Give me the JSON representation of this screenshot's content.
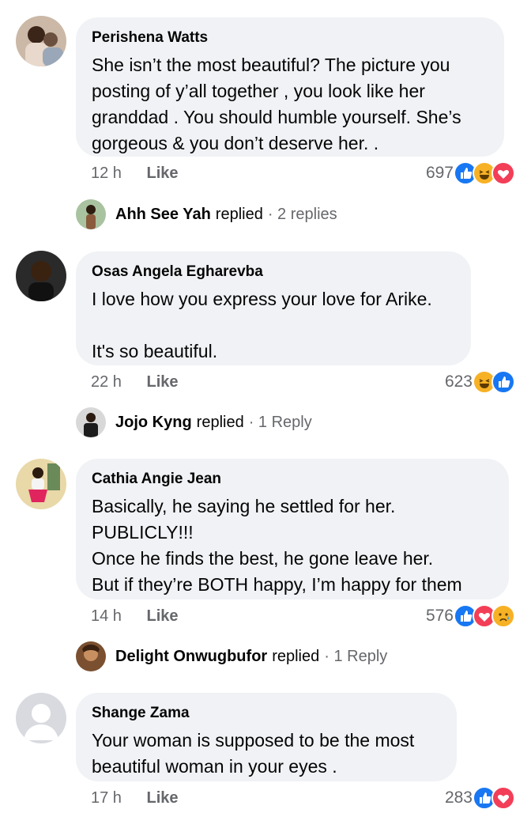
{
  "comments": [
    {
      "author": "Perishena Watts",
      "text": "She isn’t the most beautiful? The picture you posting of y’all together , you look like her granddad . You should humble yourself. She’s gorgeous & you don’t deserve her. .",
      "time": "12 h",
      "like_label": "Like",
      "reaction_count": "697",
      "reactions": [
        "like-icon",
        "haha-icon",
        "love-icon"
      ],
      "reply": {
        "name": "Ahh See Yah",
        "verb": "replied",
        "count": "· 2 replies"
      }
    },
    {
      "author": "Osas Angela Egharevba",
      "text": "I love how you express your love for Arike.\n\nIt's so beautiful.",
      "time": "22 h",
      "like_label": "Like",
      "reaction_count": "623",
      "reactions": [
        "haha-icon",
        "like-icon"
      ],
      "reply": {
        "name": "Jojo Kyng",
        "verb": "replied",
        "count": "· 1 Reply"
      }
    },
    {
      "author": "Cathia Angie Jean",
      "text": "Basically, he saying he settled for her.\nPUBLICLY!!!\nOnce he finds the best, he gone leave her.\nBut if they’re BOTH happy, I’m happy for them",
      "time": "14 h",
      "like_label": "Like",
      "reaction_count": "576",
      "reactions": [
        "like-icon",
        "love-icon",
        "sad-icon"
      ],
      "reply": {
        "name": "Delight Onwugbufor",
        "verb": "replied",
        "count": "· 1 Reply"
      }
    },
    {
      "author": "Shange Zama",
      "text": "Your woman is supposed to be the most beautiful woman in your eyes .",
      "time": "17 h",
      "like_label": "Like",
      "reaction_count": "283",
      "reactions": [
        "like-icon",
        "love-icon"
      ]
    }
  ],
  "colors": {
    "bubble": "#f0f2f5",
    "meta": "#65676b",
    "like": "#1877f2",
    "love": "#f33e58",
    "haha": "#f7b125"
  }
}
